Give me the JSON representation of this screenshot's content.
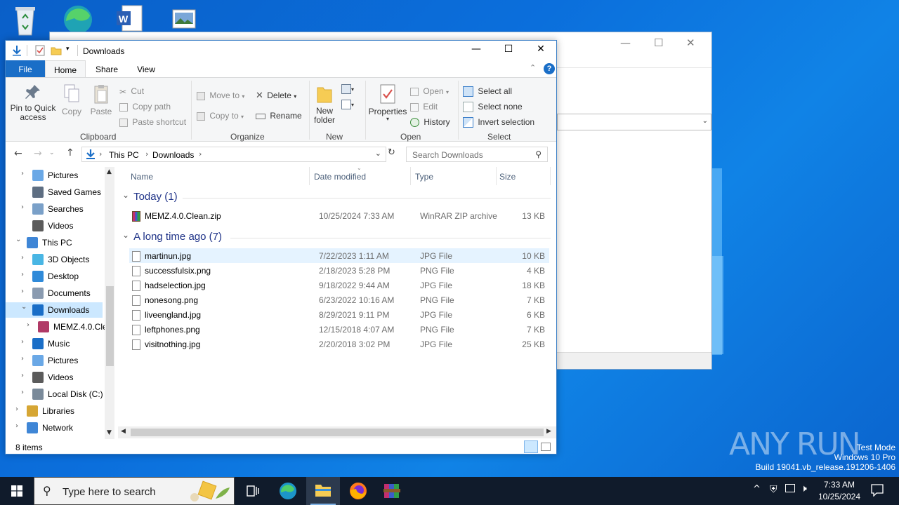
{
  "explorer": {
    "title": "Downloads",
    "ribbon_tabs": [
      "File",
      "Home",
      "Share",
      "View"
    ],
    "ribbon": {
      "clipboard": {
        "pin": "Pin to Quick\naccess",
        "copy": "Copy",
        "paste": "Paste",
        "cut": "Cut",
        "copy_path": "Copy path",
        "paste_shortcut": "Paste shortcut",
        "label": "Clipboard"
      },
      "organize": {
        "move_to": "Move to",
        "copy_to": "Copy to",
        "delete": "Delete",
        "rename": "Rename",
        "label": "Organize"
      },
      "new": {
        "new_folder": "New\nfolder",
        "label": "New"
      },
      "open": {
        "properties": "Properties",
        "open": "Open",
        "edit": "Edit",
        "history": "History",
        "label": "Open"
      },
      "select": {
        "select_all": "Select all",
        "select_none": "Select none",
        "invert": "Invert selection",
        "label": "Select"
      }
    },
    "address": {
      "crumbs": [
        "This PC",
        "Downloads"
      ]
    },
    "search_placeholder": "Search Downloads",
    "nav": [
      {
        "label": "Pictures",
        "indent": 1,
        "arrow": true
      },
      {
        "label": "Saved Games",
        "indent": 1,
        "arrow": false
      },
      {
        "label": "Searches",
        "indent": 1,
        "arrow": true
      },
      {
        "label": "Videos",
        "indent": 1,
        "arrow": false
      },
      {
        "label": "This PC",
        "indent": 0,
        "arrow": true,
        "expanded": true
      },
      {
        "label": "3D Objects",
        "indent": 1,
        "arrow": true
      },
      {
        "label": "Desktop",
        "indent": 1,
        "arrow": true
      },
      {
        "label": "Documents",
        "indent": 1,
        "arrow": true
      },
      {
        "label": "Downloads",
        "indent": 1,
        "arrow": true,
        "expanded": true,
        "selected": true
      },
      {
        "label": "MEMZ.4.0.Cle",
        "indent": 2,
        "arrow": true
      },
      {
        "label": "Music",
        "indent": 1,
        "arrow": true
      },
      {
        "label": "Pictures",
        "indent": 1,
        "arrow": true
      },
      {
        "label": "Videos",
        "indent": 1,
        "arrow": true
      },
      {
        "label": "Local Disk (C:)",
        "indent": 1,
        "arrow": true
      },
      {
        "label": "Libraries",
        "indent": 0,
        "arrow": true
      },
      {
        "label": "Network",
        "indent": 0,
        "arrow": true
      }
    ],
    "columns": {
      "name": "Name",
      "date": "Date modified",
      "type": "Type",
      "size": "Size"
    },
    "groups": [
      {
        "label": "Today (1)",
        "files": [
          {
            "name": "MEMZ.4.0.Clean.zip",
            "date": "10/25/2024 7:33 AM",
            "type": "WinRAR ZIP archive",
            "size": "13 KB",
            "icon": "winrar-icon"
          }
        ]
      },
      {
        "label": "A long time ago (7)",
        "files": [
          {
            "name": "martinun.jpg",
            "date": "7/22/2023 1:11 AM",
            "type": "JPG File",
            "size": "10 KB",
            "icon": "image-file-icon"
          },
          {
            "name": "successfulsix.png",
            "date": "2/18/2023 5:28 PM",
            "type": "PNG File",
            "size": "4 KB",
            "icon": "image-file-icon"
          },
          {
            "name": "hadselection.jpg",
            "date": "9/18/2022 9:44 AM",
            "type": "JPG File",
            "size": "18 KB",
            "icon": "image-file-icon"
          },
          {
            "name": "nonesong.png",
            "date": "6/23/2022 10:16 AM",
            "type": "PNG File",
            "size": "7 KB",
            "icon": "image-file-icon"
          },
          {
            "name": "liveengland.jpg",
            "date": "8/29/2021 9:11 PM",
            "type": "JPG File",
            "size": "6 KB",
            "icon": "image-file-icon"
          },
          {
            "name": "leftphones.png",
            "date": "12/15/2018 4:07 AM",
            "type": "PNG File",
            "size": "7 KB",
            "icon": "image-file-icon"
          },
          {
            "name": "visitnothing.jpg",
            "date": "2/20/2018 3:02 PM",
            "type": "JPG File",
            "size": "25 KB",
            "icon": "image-file-icon"
          }
        ]
      }
    ],
    "status": "8 items"
  },
  "taskbar": {
    "search_placeholder": "Type here to search",
    "time": "7:33 AM",
    "date": "10/25/2024"
  },
  "watermark": {
    "brand": "ANY RUN",
    "line1": "Test Mode",
    "line2": "Windows 10 Pro",
    "line3": "Build 19041.vb_release.191206-1406"
  },
  "colors": {
    "accent": "#1a6ec7",
    "selection": "#cce8ff",
    "hover": "#e5f3ff",
    "group_header": "#1e3287",
    "taskbar": "#101b2b"
  }
}
